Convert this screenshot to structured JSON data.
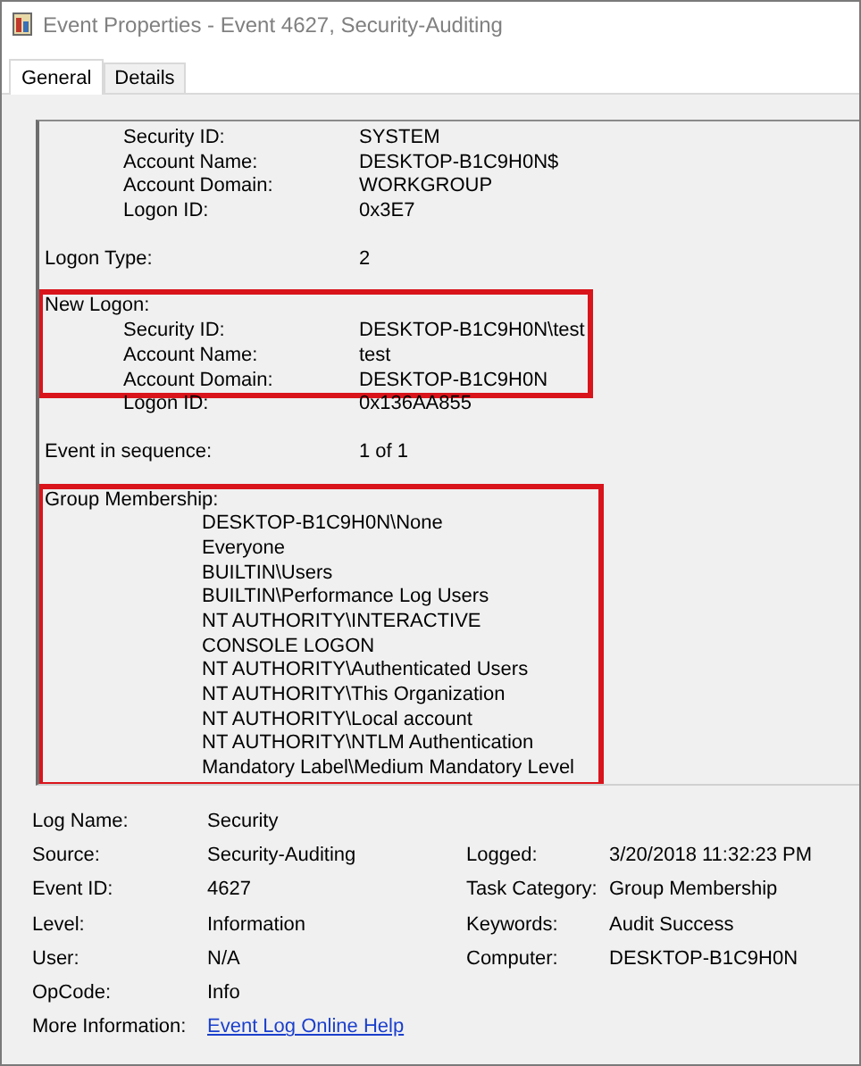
{
  "window": {
    "title": "Event Properties - Event 4627, Security-Auditing"
  },
  "tabs": [
    {
      "label": "General",
      "selected": true
    },
    {
      "label": "Details",
      "selected": false
    }
  ],
  "description": [
    [
      {
        "highlighted": false,
        "lines": [
          {
            "kind": "sub",
            "label": "Security ID:",
            "value": "SYSTEM"
          },
          {
            "kind": "sub",
            "label": "Account Name:",
            "value": "DESKTOP-B1C9H0N$"
          },
          {
            "kind": "sub",
            "label": "Account Domain:",
            "value": "WORKGROUP"
          },
          {
            "kind": "sub",
            "label": "Logon ID:",
            "value": "0x3E7"
          }
        ]
      }
    ],
    [
      {
        "highlighted": false,
        "lines": [
          {
            "kind": "field",
            "label": "Logon Type:",
            "value": "2"
          }
        ]
      }
    ],
    [
      {
        "highlighted": true,
        "lines": [
          {
            "kind": "heading",
            "label": "New Logon:"
          },
          {
            "kind": "sub",
            "label": "Security ID:",
            "value": "DESKTOP-B1C9H0N\\test"
          },
          {
            "kind": "sub",
            "label": "Account Name:",
            "value": "test"
          },
          {
            "kind": "sub",
            "label": "Account Domain:",
            "value": "DESKTOP-B1C9H0N"
          }
        ]
      },
      {
        "highlighted": false,
        "lines": [
          {
            "kind": "sub",
            "label": "Logon ID:",
            "value": "0x136AA855"
          }
        ]
      }
    ],
    [
      {
        "highlighted": false,
        "lines": [
          {
            "kind": "field",
            "label": "Event in sequence:",
            "value": "1 of 1"
          }
        ]
      }
    ],
    [
      {
        "highlighted": true,
        "lines": [
          {
            "kind": "heading",
            "label": "Group Membership:"
          },
          {
            "kind": "member",
            "value": "DESKTOP-B1C9H0N\\None"
          },
          {
            "kind": "member",
            "value": "Everyone"
          },
          {
            "kind": "member",
            "value": "BUILTIN\\Users"
          },
          {
            "kind": "member",
            "value": "BUILTIN\\Performance Log Users"
          },
          {
            "kind": "member",
            "value": "NT AUTHORITY\\INTERACTIVE"
          },
          {
            "kind": "member",
            "value": "CONSOLE LOGON"
          },
          {
            "kind": "member",
            "value": "NT AUTHORITY\\Authenticated Users"
          },
          {
            "kind": "member",
            "value": "NT AUTHORITY\\This Organization"
          },
          {
            "kind": "member",
            "value": "NT AUTHORITY\\Local account"
          },
          {
            "kind": "member",
            "value": "NT AUTHORITY\\NTLM Authentication"
          },
          {
            "kind": "member",
            "value": "Mandatory Label\\Medium Mandatory Level"
          }
        ]
      }
    ]
  ],
  "properties": [
    [
      {
        "label": "Log Name:",
        "value": "Security"
      }
    ],
    [
      {
        "label": "Source:",
        "value": "Security-Auditing"
      },
      {
        "label": "Logged:",
        "value": "3/20/2018 11:32:23 PM"
      }
    ],
    [
      {
        "label": "Event ID:",
        "value": "4627"
      },
      {
        "label": "Task Category:",
        "value": "Group Membership"
      }
    ],
    [
      {
        "label": "Level:",
        "value": "Information"
      },
      {
        "label": "Keywords:",
        "value": "Audit Success"
      }
    ],
    [
      {
        "label": "User:",
        "value": "N/A"
      },
      {
        "label": "Computer:",
        "value": "DESKTOP-B1C9H0N"
      }
    ],
    [
      {
        "label": "OpCode:",
        "value": "Info"
      }
    ],
    [
      {
        "label": "More Information:",
        "value": "Event Log Online Help",
        "kind": "link"
      }
    ]
  ]
}
